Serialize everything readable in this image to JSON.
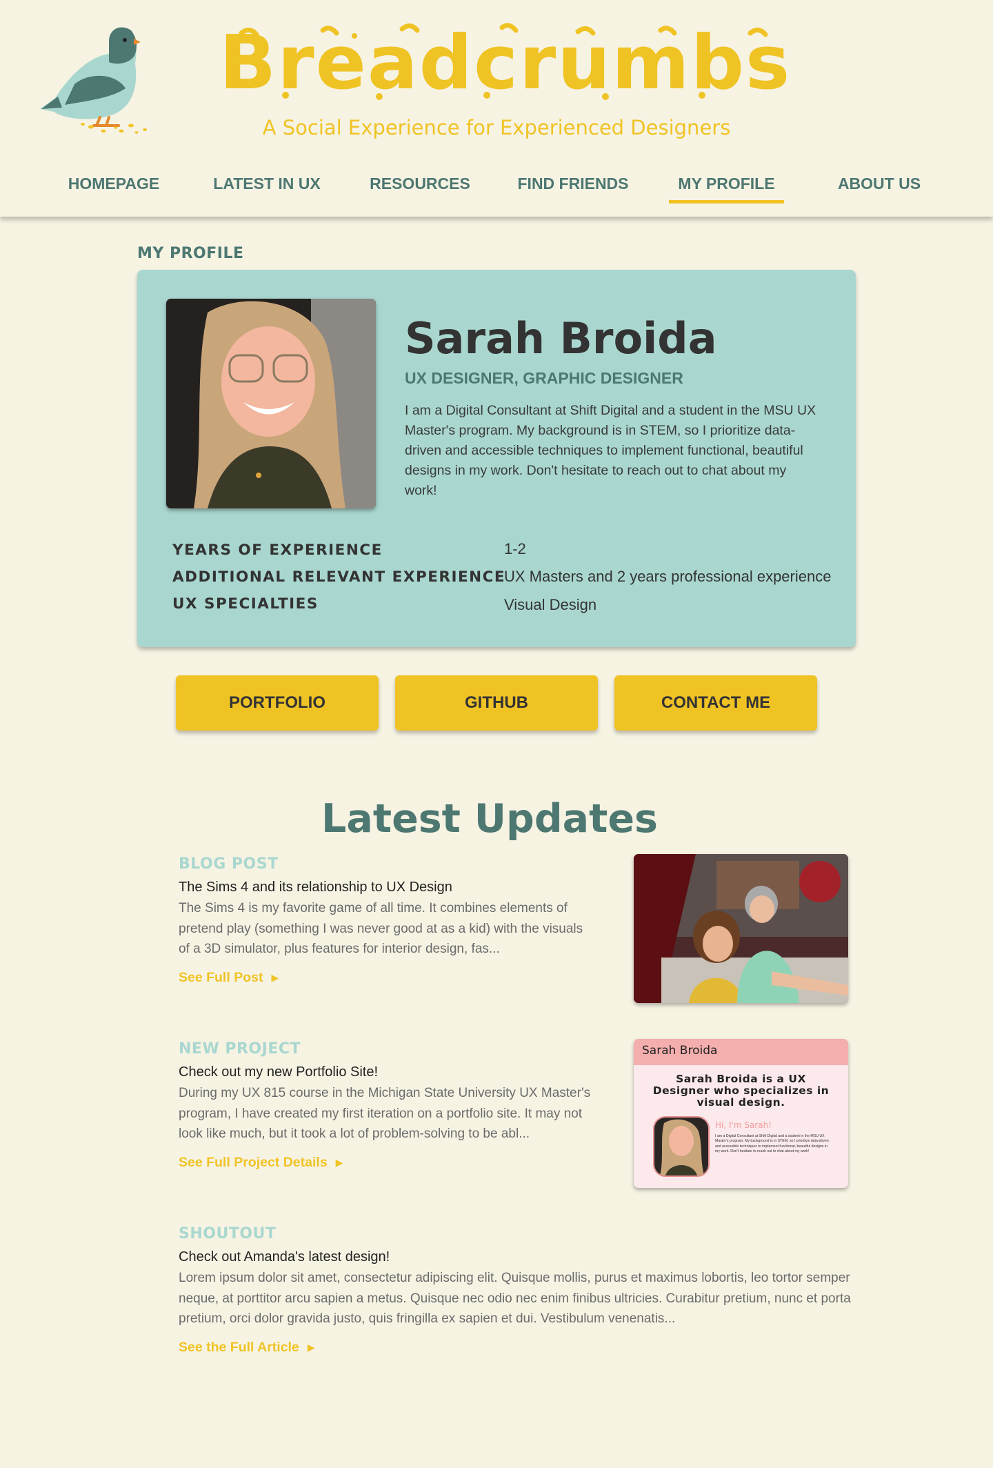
{
  "brand": {
    "title": "Breadcrumbs",
    "tagline": "A Social Experience for Experienced Designers",
    "logo_icon": "pigeon-icon"
  },
  "nav": {
    "items": [
      {
        "label": "HOMEPAGE"
      },
      {
        "label": "LATEST IN UX"
      },
      {
        "label": "RESOURCES"
      },
      {
        "label": "FIND FRIENDS"
      },
      {
        "label": "MY PROFILE",
        "active": true
      },
      {
        "label": "ABOUT US"
      }
    ]
  },
  "profile": {
    "section_label": "MY PROFILE",
    "name": "Sarah Broida",
    "roles": "UX DESIGNER, GRAPHIC DESIGNER",
    "bio": "I am a Digital Consultant at Shift Digital and a student in the MSU UX Master's program. My background is in STEM, so I prioritize data-driven and accessible techniques to implement functional, beautiful designs in my work. Don't hesitate to reach out to chat about my work!",
    "details": [
      {
        "label": "YEARS OF EXPERIENCE",
        "value": "1-2"
      },
      {
        "label": "ADDITIONAL RELEVANT EXPERIENCE",
        "value": "UX Masters and 2 years professional experience"
      },
      {
        "label": "UX SPECIALTIES",
        "value": "Visual Design"
      }
    ],
    "buttons": {
      "portfolio": "PORTFOLIO",
      "github": "GITHUB",
      "contact": "CONTACT ME"
    }
  },
  "updates": {
    "heading": "Latest Updates",
    "items": [
      {
        "category": "BLOG POST",
        "title": "The Sims 4 and its relationship to UX Design",
        "text": "The Sims 4 is my favorite game of all time. It combines elements of pretend play (something I was never good at as a kid) with the visuals of a 3D simulator, plus features for interior design, fas...",
        "link": "See Full Post"
      },
      {
        "category": "NEW PROJECT",
        "title": "Check out my new Portfolio Site!",
        "text": "During my UX 815 course in the Michigan State University UX Master's program, I have created my first iteration on a portfolio site. It may not look like much, but it took a lot of problem-solving to be abl...",
        "link": "See Full Project Details",
        "preview": {
          "header": "Sarah Broida",
          "headline": "Sarah Broida is a UX Designer who specializes in visual design.",
          "greeting": "Hi, I'm Sarah!",
          "body": "I am a Digital Consultant at Shift Digital and a student in the MSU UX Master's program. My background is in STEM, so I prioritize data-driven and accessible techniques to implement functional, beautiful designs in my work. Don't hesitate to reach out to chat about my work!"
        }
      },
      {
        "category": "SHOUTOUT",
        "title": "Check out Amanda's latest design!",
        "text": "Lorem ipsum dolor sit amet, consectetur adipiscing elit. Quisque mollis, purus et maximus lobortis, leo tortor semper neque, at porttitor arcu sapien a metus. Quisque nec odio nec enim finibus ultricies. Curabitur pretium, nunc et porta pretium, orci dolor gravida justo, quis fringilla ex sapien et dui. Vestibulum venenatis...",
        "link": "See the Full Article"
      }
    ]
  },
  "colors": {
    "background": "#f6f3e3",
    "brand_yellow": "#f0c325",
    "teal_dark": "#4d7771",
    "teal_light": "#a9d7cf",
    "text_dark": "#333333"
  }
}
